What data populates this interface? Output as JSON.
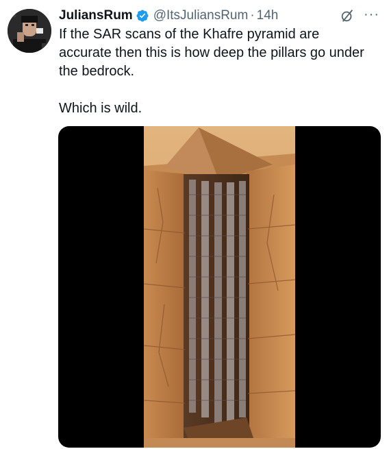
{
  "author": {
    "display_name": "JuliansRum",
    "handle": "@ItsJuliansRum",
    "separator": "·",
    "timestamp": "14h",
    "verified": true
  },
  "tweet": {
    "text": "If the SAR scans of the Khafre pyramid are accurate then this is how deep the pillars go under the bedrock.\n\nWhich is wild."
  },
  "icons": {
    "verified": "verified-badge-icon",
    "grok": "grok-icon",
    "more": "more-options-icon"
  },
  "media": {
    "description_icon": "pyramid-cross-section-image"
  },
  "colors": {
    "verified_blue": "#1d9bf0",
    "secondary_text": "#536471",
    "primary_text": "#0f1419",
    "media_bg": "#000000",
    "sand": "#d9a56b",
    "rock": "#b87a45"
  }
}
